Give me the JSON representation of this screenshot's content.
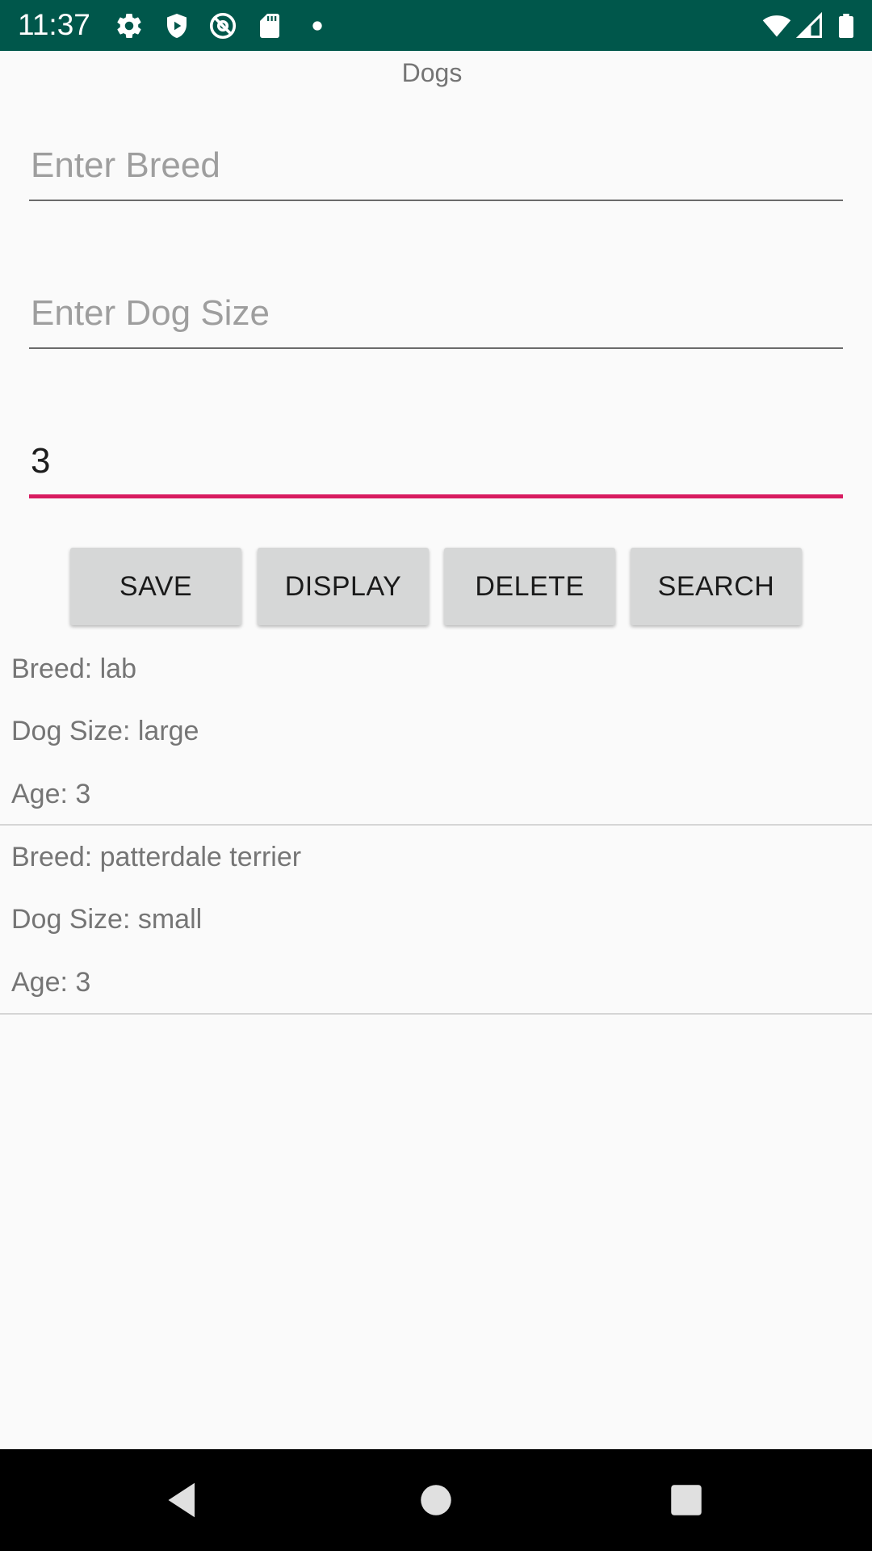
{
  "status_bar": {
    "time": "11:37",
    "left_icons": [
      "settings-icon",
      "shield-icon",
      "at-sign-icon",
      "sd-card-icon",
      "dot-icon"
    ],
    "right_icons": [
      "wifi-icon",
      "signal-icon",
      "battery-icon"
    ],
    "color": "#00574b"
  },
  "app": {
    "title": "Dogs"
  },
  "form": {
    "breed": {
      "placeholder": "Enter Breed",
      "value": ""
    },
    "size": {
      "placeholder": "Enter Dog Size",
      "value": ""
    },
    "age": {
      "placeholder": "",
      "value": "3"
    },
    "accent_color": "#d81b60"
  },
  "buttons": {
    "save": "SAVE",
    "display": "DISPLAY",
    "delete": "DELETE",
    "search": "SEARCH"
  },
  "results": [
    {
      "breed": "Breed: lab",
      "size": "Dog Size: large",
      "age": "Age: 3"
    },
    {
      "breed": "Breed: patterdale terrier",
      "size": "Dog Size: small",
      "age": "Age: 3"
    }
  ],
  "nav_bar": {
    "icons": [
      "back-icon",
      "home-icon",
      "recents-icon"
    ]
  }
}
